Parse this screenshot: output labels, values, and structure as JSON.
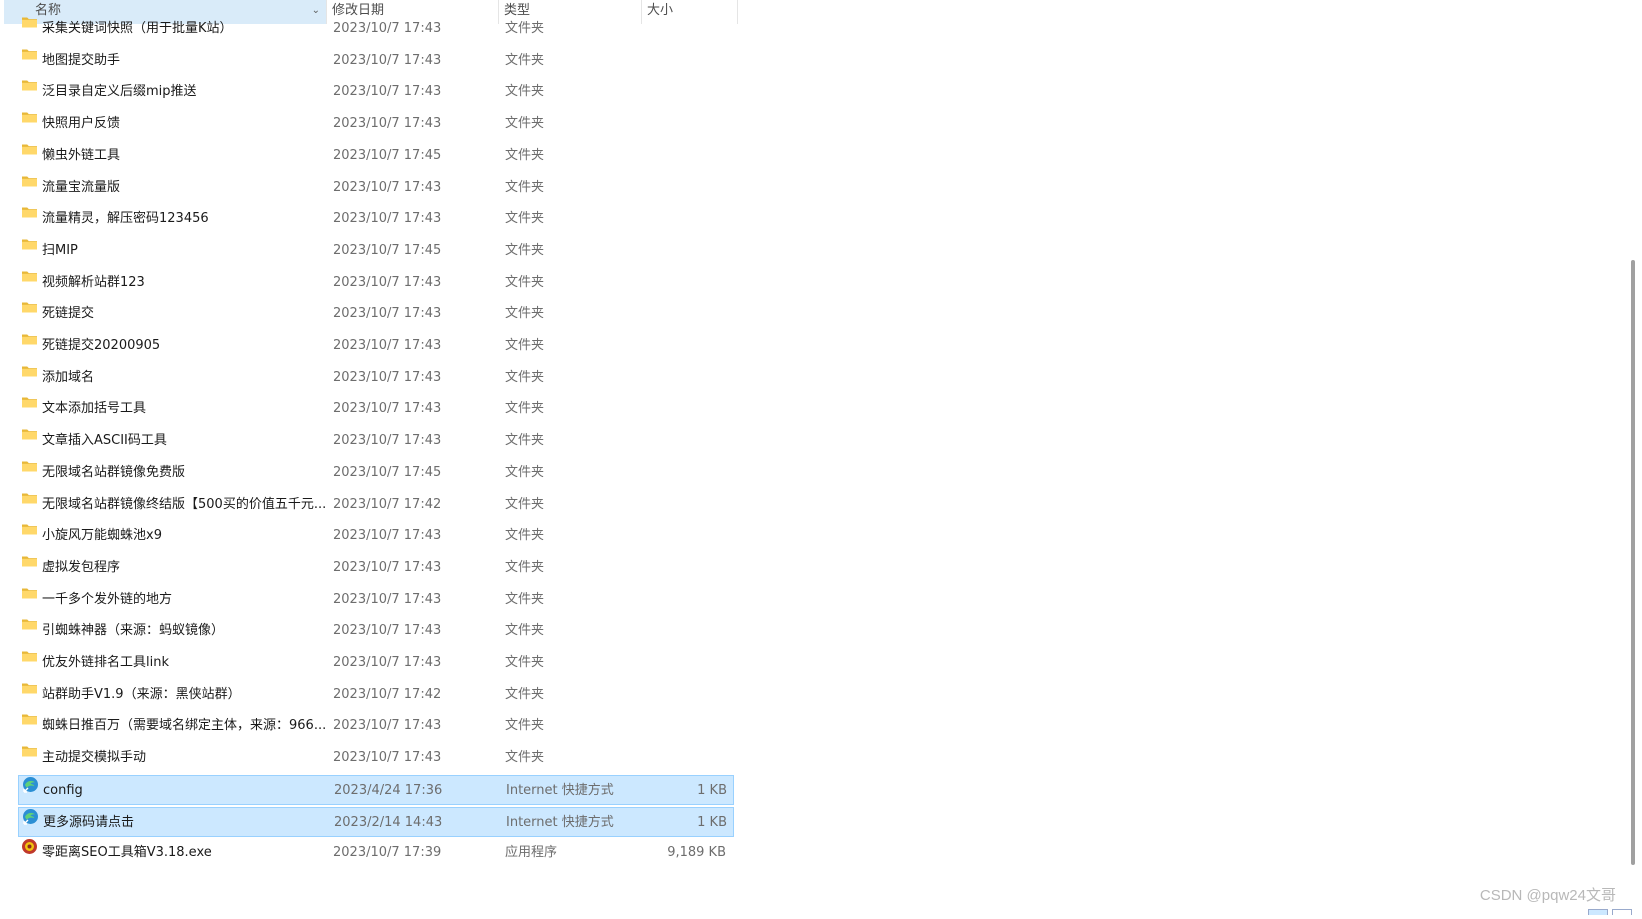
{
  "columns": {
    "name": "名称",
    "date": "修改日期",
    "type": "类型",
    "size": "大小"
  },
  "icons": {
    "folder": "folder-icon",
    "shortcut": "internet-shortcut-icon",
    "exe": "app-exe-icon",
    "sort": "chevron-down-icon"
  },
  "colors": {
    "folder_fill": "#ffd86a",
    "folder_dark": "#e8b839",
    "selected_bg": "#cce8ff",
    "selected_border": "#99d1ff"
  },
  "files": [
    {
      "name": "采集关键词快照（用于批量K站）",
      "date": "2023/10/7 17:43",
      "type": "文件夹",
      "size": "",
      "icon": "folder",
      "selected": false
    },
    {
      "name": "地图提交助手",
      "date": "2023/10/7 17:43",
      "type": "文件夹",
      "size": "",
      "icon": "folder",
      "selected": false
    },
    {
      "name": "泛目录自定义后缀mip推送",
      "date": "2023/10/7 17:43",
      "type": "文件夹",
      "size": "",
      "icon": "folder",
      "selected": false
    },
    {
      "name": "快照用户反馈",
      "date": "2023/10/7 17:43",
      "type": "文件夹",
      "size": "",
      "icon": "folder",
      "selected": false
    },
    {
      "name": "懒虫外链工具",
      "date": "2023/10/7 17:45",
      "type": "文件夹",
      "size": "",
      "icon": "folder",
      "selected": false
    },
    {
      "name": "流量宝流量版",
      "date": "2023/10/7 17:43",
      "type": "文件夹",
      "size": "",
      "icon": "folder",
      "selected": false
    },
    {
      "name": "流量精灵，解压密码123456",
      "date": "2023/10/7 17:43",
      "type": "文件夹",
      "size": "",
      "icon": "folder",
      "selected": false
    },
    {
      "name": "扫MIP",
      "date": "2023/10/7 17:45",
      "type": "文件夹",
      "size": "",
      "icon": "folder",
      "selected": false
    },
    {
      "name": "视频解析站群123",
      "date": "2023/10/7 17:43",
      "type": "文件夹",
      "size": "",
      "icon": "folder",
      "selected": false
    },
    {
      "name": "死链提交",
      "date": "2023/10/7 17:43",
      "type": "文件夹",
      "size": "",
      "icon": "folder",
      "selected": false
    },
    {
      "name": "死链提交20200905",
      "date": "2023/10/7 17:43",
      "type": "文件夹",
      "size": "",
      "icon": "folder",
      "selected": false
    },
    {
      "name": "添加域名",
      "date": "2023/10/7 17:43",
      "type": "文件夹",
      "size": "",
      "icon": "folder",
      "selected": false
    },
    {
      "name": "文本添加括号工具",
      "date": "2023/10/7 17:43",
      "type": "文件夹",
      "size": "",
      "icon": "folder",
      "selected": false
    },
    {
      "name": "文章插入ASCII码工具",
      "date": "2023/10/7 17:43",
      "type": "文件夹",
      "size": "",
      "icon": "folder",
      "selected": false
    },
    {
      "name": "无限域名站群镜像免费版",
      "date": "2023/10/7 17:45",
      "type": "文件夹",
      "size": "",
      "icon": "folder",
      "selected": false
    },
    {
      "name": "无限域名站群镜像终结版【500买的价值五千元...",
      "date": "2023/10/7 17:42",
      "type": "文件夹",
      "size": "",
      "icon": "folder",
      "selected": false
    },
    {
      "name": "小旋风万能蜘蛛池x9",
      "date": "2023/10/7 17:43",
      "type": "文件夹",
      "size": "",
      "icon": "folder",
      "selected": false
    },
    {
      "name": "虚拟发包程序",
      "date": "2023/10/7 17:43",
      "type": "文件夹",
      "size": "",
      "icon": "folder",
      "selected": false
    },
    {
      "name": "一千多个发外链的地方",
      "date": "2023/10/7 17:43",
      "type": "文件夹",
      "size": "",
      "icon": "folder",
      "selected": false
    },
    {
      "name": "引蜘蛛神器（来源：蚂蚁镜像）",
      "date": "2023/10/7 17:43",
      "type": "文件夹",
      "size": "",
      "icon": "folder",
      "selected": false
    },
    {
      "name": "优友外链排名工具link",
      "date": "2023/10/7 17:43",
      "type": "文件夹",
      "size": "",
      "icon": "folder",
      "selected": false
    },
    {
      "name": "站群助手V1.9（来源：黑侠站群）",
      "date": "2023/10/7 17:42",
      "type": "文件夹",
      "size": "",
      "icon": "folder",
      "selected": false
    },
    {
      "name": "蜘蛛日推百万（需要域名绑定主体，来源：966...",
      "date": "2023/10/7 17:43",
      "type": "文件夹",
      "size": "",
      "icon": "folder",
      "selected": false
    },
    {
      "name": "主动提交模拟手动",
      "date": "2023/10/7 17:43",
      "type": "文件夹",
      "size": "",
      "icon": "folder",
      "selected": false
    },
    {
      "name": "config",
      "date": "2023/4/24 17:36",
      "type": "Internet 快捷方式",
      "size": "1 KB",
      "icon": "shortcut",
      "selected": true
    },
    {
      "name": "更多源码请点击",
      "date": "2023/2/14 14:43",
      "type": "Internet 快捷方式",
      "size": "1 KB",
      "icon": "shortcut",
      "selected": true
    },
    {
      "name": "零距离SEO工具箱V3.18.exe",
      "date": "2023/10/7 17:39",
      "type": "应用程序",
      "size": "9,189 KB",
      "icon": "exe",
      "selected": false
    }
  ],
  "watermark": "CSDN @pqw24文哥"
}
